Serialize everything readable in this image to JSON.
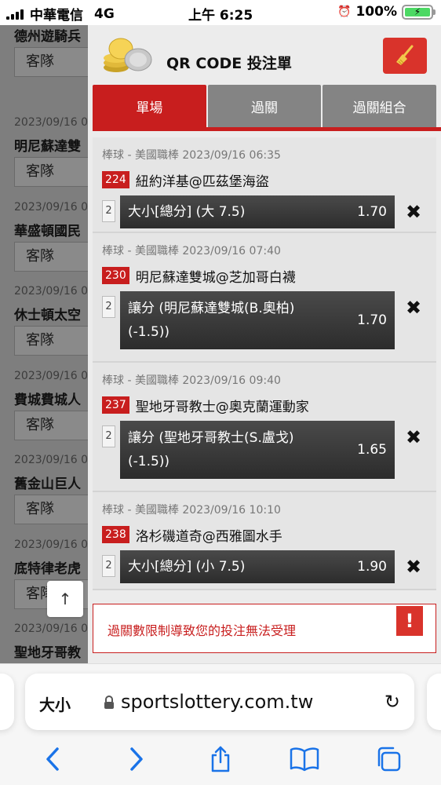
{
  "status_bar": {
    "carrier": "中華電信",
    "network": "4G",
    "time": "上午 6:25",
    "battery": "100%"
  },
  "background_list": {
    "items": [
      {
        "date": "",
        "team": "德州遊騎兵",
        "button": "客隊"
      },
      {
        "date": "2023/09/16 0",
        "team": "明尼蘇達雙",
        "button": "客隊"
      },
      {
        "date": "2023/09/16 0",
        "team": "華盛頓國民",
        "button": "客隊"
      },
      {
        "date": "2023/09/16 0",
        "team": "休士頓太空",
        "button": "客隊"
      },
      {
        "date": "2023/09/16 0",
        "team": "費城費城人",
        "button": "客隊"
      },
      {
        "date": "2023/09/16 0",
        "team": "舊金山巨人",
        "button": "客隊"
      },
      {
        "date": "2023/09/16 0",
        "team": "底特律老虎",
        "button": "客隊"
      },
      {
        "date": "2023/09/16 0",
        "team": "聖地牙哥教",
        "button": "客隊"
      }
    ],
    "scroll_up": "↑"
  },
  "panel": {
    "title": "QR CODE 投注單",
    "clear_icon": "broom-icon",
    "tabs": [
      {
        "label": "單場",
        "active": true
      },
      {
        "label": "過關",
        "active": false
      },
      {
        "label": "過關組合",
        "active": false
      }
    ],
    "bets": [
      {
        "meta": "棒球 - 美國職棒 2023/09/16 06:35",
        "number": "224",
        "teams": "紐約洋基@匹茲堡海盜",
        "qty": "2",
        "selection": "大小[總分] (大 7.5)",
        "odds": "1.70"
      },
      {
        "meta": "棒球 - 美國職棒 2023/09/16 07:40",
        "number": "230",
        "teams": "明尼蘇達雙城@芝加哥白襪",
        "qty": "2",
        "selection": "讓分 (明尼蘇達雙城(B.奧柏) (-1.5))",
        "odds": "1.70"
      },
      {
        "meta": "棒球 - 美國職棒 2023/09/16 09:40",
        "number": "237",
        "teams": "聖地牙哥教士@奧克蘭運動家",
        "qty": "2",
        "selection": "讓分 (聖地牙哥教士(S.盧戈) (-1.5))",
        "odds": "1.65"
      },
      {
        "meta": "棒球 - 美國職棒 2023/09/16 10:10",
        "number": "238",
        "teams": "洛杉磯道奇@西雅圖水手",
        "qty": "2",
        "selection": "大小[總分] (小 7.5)",
        "odds": "1.90"
      }
    ],
    "remove_symbol": "✖",
    "warning": {
      "text": "過關數限制導致您的投注無法受理",
      "icon": "!"
    }
  },
  "browser": {
    "text_size": "大小",
    "url": "sportslottery.com.tw",
    "reload": "↻"
  },
  "colors": {
    "accent_red": "#c81e1e",
    "tab_gray": "#848484",
    "overlay_gray": "#7e7e7e"
  }
}
